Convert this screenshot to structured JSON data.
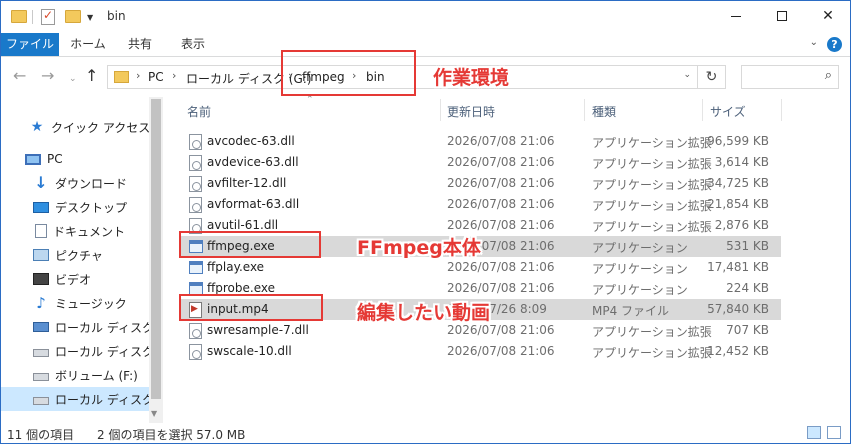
{
  "window": {
    "title": "bin"
  },
  "ribbon": {
    "tabs": [
      "ファイル",
      "ホーム",
      "共有",
      "表示"
    ],
    "help": "?"
  },
  "address": {
    "crumbs": [
      "PC",
      "ローカル ディスク (G:)",
      "ffmpeg",
      "bin"
    ],
    "search_placeholder": ""
  },
  "nav": {
    "items": [
      {
        "label": "クイック アクセス",
        "icon": "star-icon"
      },
      {
        "label": "PC",
        "icon": "computer-icon"
      },
      {
        "label": "ダウンロード",
        "icon": "download-icon"
      },
      {
        "label": "デスクトップ",
        "icon": "desktop-icon"
      },
      {
        "label": "ドキュメント",
        "icon": "document-icon"
      },
      {
        "label": "ピクチャ",
        "icon": "pictures-icon"
      },
      {
        "label": "ビデオ",
        "icon": "video-icon"
      },
      {
        "label": "ミュージック",
        "icon": "music-icon"
      },
      {
        "label": "ローカル ディスク (C:)",
        "icon": "windows-drive-icon"
      },
      {
        "label": "ローカル ディスク (D:)",
        "icon": "drive-icon"
      },
      {
        "label": "ボリューム (F:)",
        "icon": "drive-icon"
      },
      {
        "label": "ローカル ディスク (G:)",
        "icon": "drive-icon",
        "selected": true
      }
    ]
  },
  "columns": {
    "name": "名前",
    "date": "更新日時",
    "type": "種類",
    "size": "サイズ"
  },
  "files": [
    {
      "name": "avcodec-63.dll",
      "date": "2026/07/08 21:06",
      "type": "アプリケーション拡張",
      "size": "96,599 KB",
      "kind": "dll"
    },
    {
      "name": "avdevice-63.dll",
      "date": "2026/07/08 21:06",
      "type": "アプリケーション拡張",
      "size": "3,614 KB",
      "kind": "dll"
    },
    {
      "name": "avfilter-12.dll",
      "date": "2026/07/08 21:06",
      "type": "アプリケーション拡張",
      "size": "34,725 KB",
      "kind": "dll"
    },
    {
      "name": "avformat-63.dll",
      "date": "2026/07/08 21:06",
      "type": "アプリケーション拡張",
      "size": "21,854 KB",
      "kind": "dll"
    },
    {
      "name": "avutil-61.dll",
      "date": "2026/07/08 21:06",
      "type": "アプリケーション拡張",
      "size": "2,876 KB",
      "kind": "dll"
    },
    {
      "name": "ffmpeg.exe",
      "date": "2026/07/08 21:06",
      "type": "アプリケーション",
      "size": "531 KB",
      "kind": "exe",
      "selected": true
    },
    {
      "name": "ffplay.exe",
      "date": "2026/07/08 21:06",
      "type": "アプリケーション",
      "size": "17,481 KB",
      "kind": "exe"
    },
    {
      "name": "ffprobe.exe",
      "date": "2026/07/08 21:06",
      "type": "アプリケーション",
      "size": "224 KB",
      "kind": "exe"
    },
    {
      "name": "input.mp4",
      "date": "2026/07/26 8:09",
      "type": "MP4 ファイル",
      "size": "57,840 KB",
      "kind": "mp4",
      "selected": true
    },
    {
      "name": "swresample-7.dll",
      "date": "2026/07/08 21:06",
      "type": "アプリケーション拡張",
      "size": "707 KB",
      "kind": "dll"
    },
    {
      "name": "swscale-10.dll",
      "date": "2026/07/08 21:06",
      "type": "アプリケーション拡張",
      "size": "12,452 KB",
      "kind": "dll"
    }
  ],
  "annotations": {
    "work_env": "作業環境",
    "ffmpeg_body": "FFmpeg本体",
    "video_to_edit": "編集したい動画"
  },
  "status": {
    "count": "11 個の項目",
    "selection": "2 個の項目を選択  57.0 MB"
  },
  "colors": {
    "accent": "#1979ca",
    "annotation": "#e53935",
    "selection": "#cce8ff"
  }
}
